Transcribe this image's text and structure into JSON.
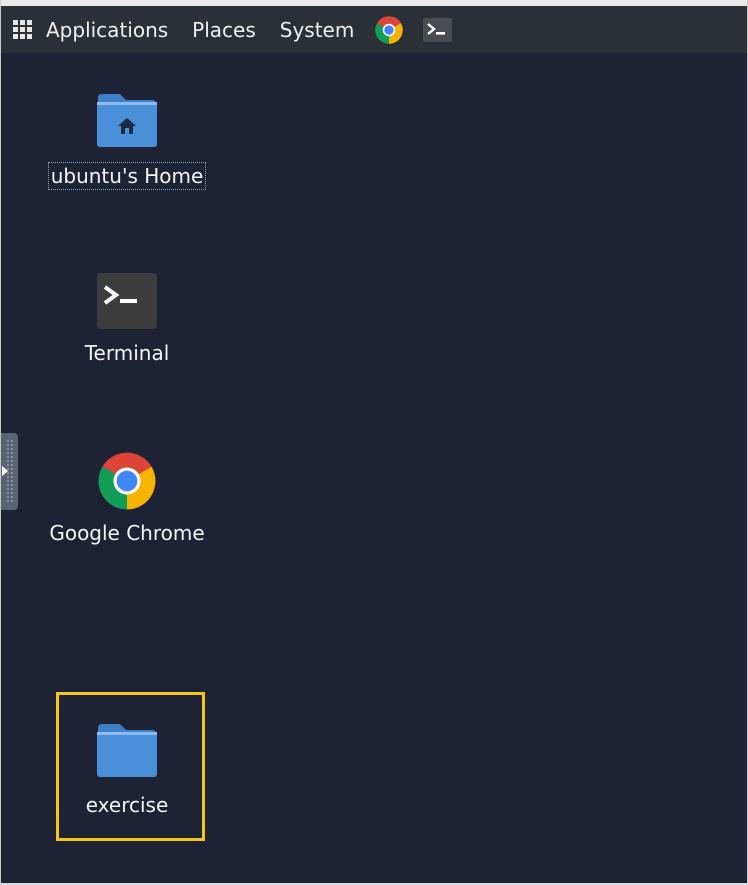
{
  "panel": {
    "menus": [
      "Applications",
      "Places",
      "System"
    ],
    "launchers": [
      "chrome-icon",
      "terminal-icon"
    ]
  },
  "desktop": {
    "icons": [
      {
        "label": "ubuntu's Home",
        "icon": "home-folder-icon"
      },
      {
        "label": "Terminal",
        "icon": "terminal-icon"
      },
      {
        "label": "Google Chrome",
        "icon": "chrome-icon"
      },
      {
        "label": "exercise",
        "icon": "folder-icon"
      }
    ]
  },
  "colors": {
    "desktop_bg": "#1d2334",
    "panel_bg": "#2b2f36",
    "folder_blue": "#4a90d9",
    "highlight": "#f5c518"
  }
}
